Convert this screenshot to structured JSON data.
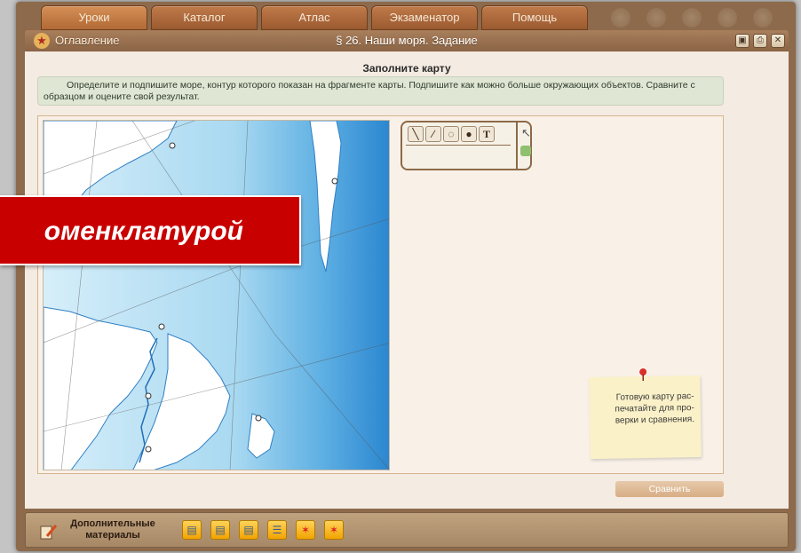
{
  "tabs": [
    {
      "label": "Уроки"
    },
    {
      "label": "Каталог"
    },
    {
      "label": "Атлас"
    },
    {
      "label": "Экзаменатор"
    },
    {
      "label": "Помощь"
    }
  ],
  "titlebar": {
    "toc_label": "Оглавление",
    "page_title": "§ 26. Наши моря. Задание",
    "buttons": [
      "save-icon",
      "print-icon",
      "close-icon"
    ]
  },
  "task": {
    "title": "Заполните карту",
    "instruction": "Определите и подпишите море, контур которого показан на фрагменте карты. Подпишите как можно больше окружающих объектов. Сравните с образцом и оцените свой результат."
  },
  "toolbox": {
    "tools": [
      "line-icon",
      "brush-icon",
      "fill-icon",
      "palette-icon",
      "text-tool-icon"
    ],
    "text_tool_glyph": "T",
    "side_tools": [
      "cursor-icon",
      "eraser-icon"
    ]
  },
  "note": {
    "text": "Готовую карту рас-печатайте для про-верки и сравнения."
  },
  "compare_button": {
    "label": "Сравнить"
  },
  "bottombar": {
    "extra_label": "Дополнительные материалы",
    "materials": [
      "book-icon",
      "book-icon",
      "book-icon",
      "table-icon",
      "star-icon",
      "star-icon"
    ]
  },
  "banner": {
    "text": "оменклатурой"
  },
  "colors": {
    "frame": "#8d6a4b",
    "tab": "#b36a36",
    "banner": "#c80000",
    "instruction_bg": "#dfe6d4",
    "sea_deep": "#2f8fd8",
    "sea_light": "#bfe3f6"
  }
}
